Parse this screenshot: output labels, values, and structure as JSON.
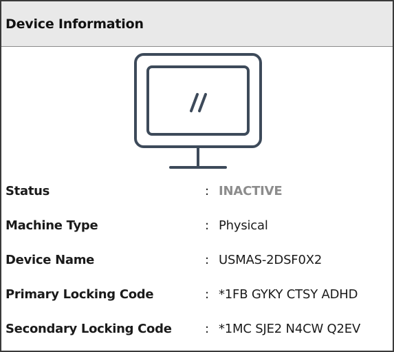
{
  "panel": {
    "title": "Device Information",
    "icon": "desktop-monitor-icon"
  },
  "fields": [
    {
      "label": "Status",
      "separator": ":",
      "value": "INACTIVE"
    },
    {
      "label": "Machine Type",
      "separator": ":",
      "value": "Physical"
    },
    {
      "label": "Device Name",
      "separator": ":",
      "value": "USMAS-2DSF0X2"
    },
    {
      "label": "Primary Locking Code",
      "separator": ":",
      "value": "*1FB GYKY CTSY ADHD"
    },
    {
      "label": "Secondary Locking Code",
      "separator": ":",
      "value": "*1MC SJE2 N4CW Q2EV"
    }
  ],
  "colors": {
    "status_inactive": "#8c8c8c",
    "icon_stroke": "#3d4a5a",
    "header_bg": "#e9e9e9"
  }
}
